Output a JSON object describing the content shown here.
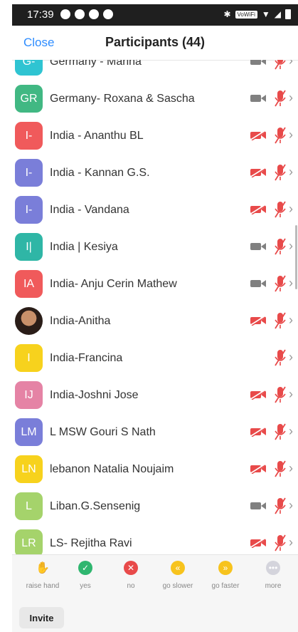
{
  "statusbar": {
    "time": "17:39",
    "wifi_badge": "VoWiFi"
  },
  "header": {
    "close_label": "Close",
    "title": "Participants (44)"
  },
  "colors": {
    "accent": "#2d8cff",
    "muted_red": "#e84a4a",
    "device_gray": "#808080"
  },
  "participants": [
    {
      "initials": "G-",
      "name": "Germany - Marina",
      "color": "#2fc4d2",
      "video": "on",
      "mic": "muted"
    },
    {
      "initials": "GR",
      "name": "Germany- Roxana & Sascha",
      "color": "#41b883",
      "video": "on",
      "mic": "muted"
    },
    {
      "initials": "I-",
      "name": "India - Ananthu BL",
      "color": "#f05a5b",
      "video": "off",
      "mic": "muted"
    },
    {
      "initials": "I-",
      "name": "India - Kannan G.S.",
      "color": "#7a7ed9",
      "video": "off",
      "mic": "muted"
    },
    {
      "initials": "I-",
      "name": "India - Vandana",
      "color": "#7a7ed9",
      "video": "off",
      "mic": "muted"
    },
    {
      "initials": "I|",
      "name": "India | Kesiya",
      "color": "#2fb6a6",
      "video": "on",
      "mic": "muted"
    },
    {
      "initials": "IA",
      "name": "India- Anju Cerin Mathew",
      "color": "#f05a5b",
      "video": "on",
      "mic": "muted"
    },
    {
      "initials": "",
      "name": "India-Anitha",
      "color": "#6b4a3a",
      "video": "off",
      "mic": "muted",
      "photo": true
    },
    {
      "initials": "I",
      "name": "India-Francina",
      "color": "#f7d21d",
      "video": "none",
      "mic": "muted"
    },
    {
      "initials": "IJ",
      "name": "India-Joshni Jose",
      "color": "#e583a5",
      "video": "off",
      "mic": "muted"
    },
    {
      "initials": "LM",
      "name": "L MSW Gouri S Nath",
      "color": "#7a7ed9",
      "video": "off",
      "mic": "muted"
    },
    {
      "initials": "LN",
      "name": "lebanon Natalia Noujaim",
      "color": "#f7d21d",
      "video": "off",
      "mic": "muted"
    },
    {
      "initials": "L",
      "name": "Liban.G.Sensenig",
      "color": "#a5d36b",
      "video": "on",
      "mic": "muted"
    },
    {
      "initials": "LR",
      "name": "LS- Rejitha Ravi",
      "color": "#a5d36b",
      "video": "off",
      "mic": "muted"
    }
  ],
  "reactions": [
    {
      "label": "raise hand",
      "icon": "raise-hand-icon",
      "color": "#2d8cff",
      "glyph": "✋"
    },
    {
      "label": "yes",
      "icon": "check-icon",
      "color": "#2fb66f",
      "glyph": "✓"
    },
    {
      "label": "no",
      "icon": "x-icon",
      "color": "#e84a4a",
      "glyph": "✕"
    },
    {
      "label": "go slower",
      "icon": "rewind-icon",
      "color": "#f7c31d",
      "glyph": "«"
    },
    {
      "label": "go faster",
      "icon": "fast-forward-icon",
      "color": "#f7c31d",
      "glyph": "»"
    },
    {
      "label": "more",
      "icon": "more-icon",
      "color": "#d4d4dc",
      "glyph": "•••"
    }
  ],
  "footer": {
    "invite_label": "Invite"
  }
}
